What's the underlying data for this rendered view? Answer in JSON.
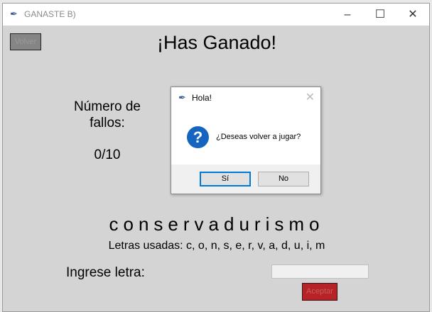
{
  "window": {
    "title": "GANASTE B)"
  },
  "main": {
    "back_label": "Volver",
    "heading": "¡Has Ganado!",
    "fails_label": "Número de fallos:",
    "fails_value": "0/10",
    "word": "conservadurismo",
    "used_letters": "Letras usadas: c, o, n, s, e, r, v, a, d, u, i, m",
    "input_label": "Ingrese letra:",
    "input_value": "",
    "accept_label": "Aceptar"
  },
  "dialog": {
    "title": "Hola!",
    "message": "¿Deseas volver a jugar?",
    "yes_label": "Sí",
    "no_label": "No"
  },
  "colors": {
    "background": "#d4d4d4",
    "accept": "#b52326",
    "question_icon": "#1565c0"
  }
}
